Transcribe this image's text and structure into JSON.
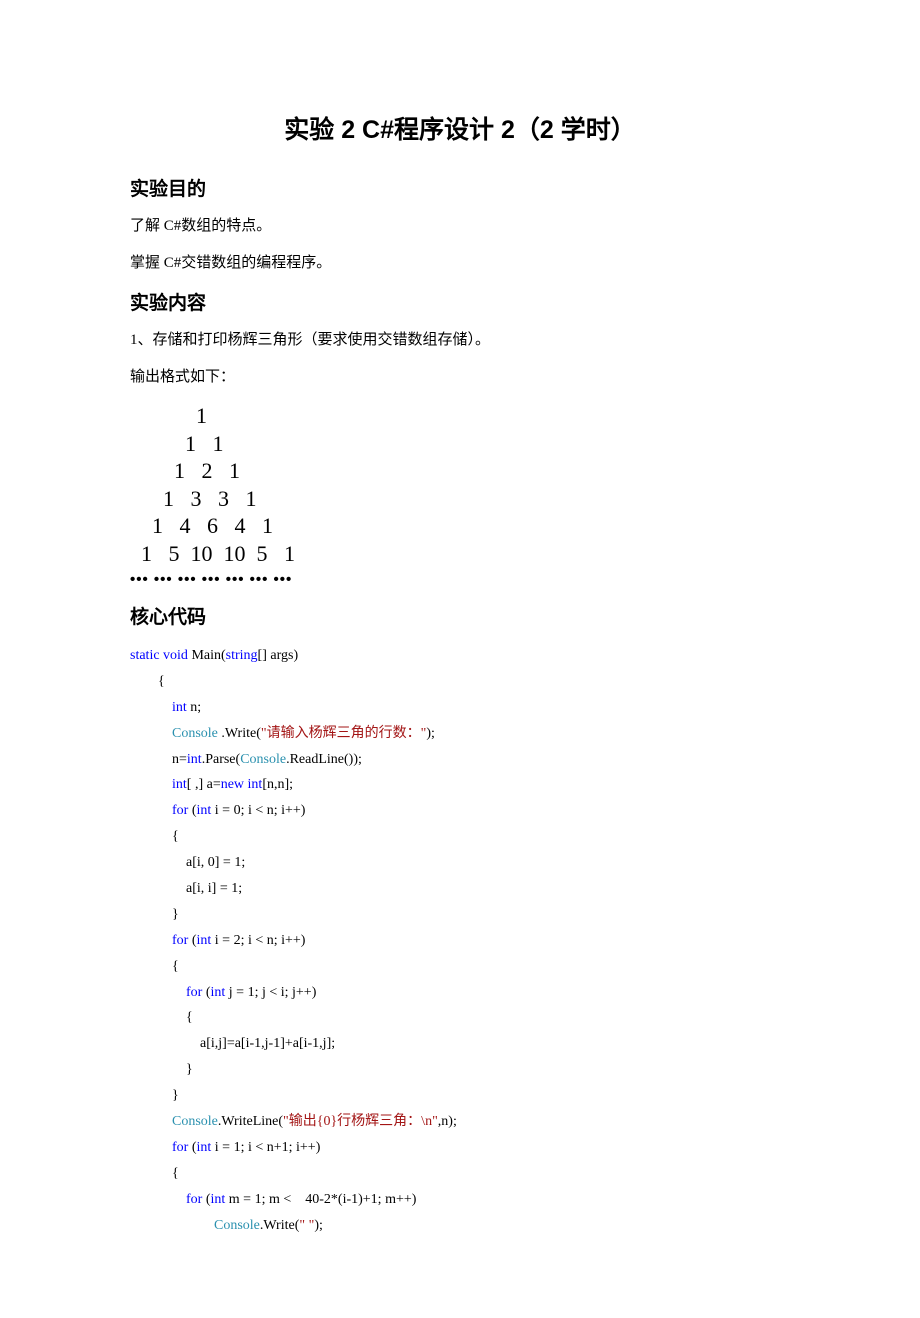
{
  "title": "实验 2    C#程序设计 2（2 学时）",
  "sections": {
    "purpose_heading": "实验目的",
    "purpose_p1": "了解 C#数组的特点。",
    "purpose_p2": "掌握 C#交错数组的编程程序。",
    "content_heading": "实验内容",
    "content_p1": "1、存储和打印杨辉三角形（要求使用交错数组存储）。",
    "content_p2": "输出格式如下：",
    "code_heading": "核心代码"
  },
  "triangle": {
    "rows": [
      "            1",
      "          1   1",
      "        1   2   1",
      "      1   3   3   1",
      "    1   4   6   4   1",
      "  1   5  10  10  5   1"
    ],
    "dots": "•••  •••  •••  •••   •••  ••• •••"
  },
  "code": {
    "lines": [
      [
        {
          "t": "static void",
          "c": "kw"
        },
        {
          "t": " Main("
        },
        {
          "t": "string",
          "c": "kw"
        },
        {
          "t": "[] args)"
        }
      ],
      [
        {
          "t": "        {"
        }
      ],
      [
        {
          "t": "            "
        },
        {
          "t": "int",
          "c": "kw"
        },
        {
          "t": " n;"
        }
      ],
      [
        {
          "t": "            "
        },
        {
          "t": "Console",
          "c": "cls"
        },
        {
          "t": " .Write("
        },
        {
          "t": "\"请输入杨辉三角的行数：\"",
          "c": "str"
        },
        {
          "t": ");"
        }
      ],
      [
        {
          "t": "            n="
        },
        {
          "t": "int",
          "c": "kw"
        },
        {
          "t": ".Parse("
        },
        {
          "t": "Console",
          "c": "cls"
        },
        {
          "t": ".ReadLine());"
        }
      ],
      [
        {
          "t": "            "
        },
        {
          "t": "int",
          "c": "kw"
        },
        {
          "t": "[ ,] a="
        },
        {
          "t": "new int",
          "c": "kw"
        },
        {
          "t": "[n,n];"
        }
      ],
      [
        {
          "t": "            "
        },
        {
          "t": "for",
          "c": "kw"
        },
        {
          "t": " ("
        },
        {
          "t": "int",
          "c": "kw"
        },
        {
          "t": " i = 0; i < n; i++)"
        }
      ],
      [
        {
          "t": "            {"
        }
      ],
      [
        {
          "t": "                a[i, 0] = 1;"
        }
      ],
      [
        {
          "t": "                a[i, i] = 1;"
        }
      ],
      [
        {
          "t": "            }"
        }
      ],
      [
        {
          "t": "            "
        },
        {
          "t": "for",
          "c": "kw"
        },
        {
          "t": " ("
        },
        {
          "t": "int",
          "c": "kw"
        },
        {
          "t": " i = 2; i < n; i++)"
        }
      ],
      [
        {
          "t": "            {"
        }
      ],
      [
        {
          "t": "                "
        },
        {
          "t": "for",
          "c": "kw"
        },
        {
          "t": " ("
        },
        {
          "t": "int",
          "c": "kw"
        },
        {
          "t": " j = 1; j < i; j++)"
        }
      ],
      [
        {
          "t": "                {"
        }
      ],
      [
        {
          "t": "                    a[i,j]=a[i-1,j-1]+a[i-1,j];"
        }
      ],
      [
        {
          "t": "                }"
        }
      ],
      [
        {
          "t": "            }"
        }
      ],
      [
        {
          "t": "            "
        },
        {
          "t": "Console",
          "c": "cls"
        },
        {
          "t": ".WriteLine("
        },
        {
          "t": "\"输出{0}行杨辉三角：\\n\"",
          "c": "str"
        },
        {
          "t": ",n);"
        }
      ],
      [
        {
          "t": "            "
        },
        {
          "t": "for",
          "c": "kw"
        },
        {
          "t": " ("
        },
        {
          "t": "int",
          "c": "kw"
        },
        {
          "t": " i = 1; i < n+1; i++)"
        }
      ],
      [
        {
          "t": "            {"
        }
      ],
      [
        {
          "t": "                "
        },
        {
          "t": "for",
          "c": "kw"
        },
        {
          "t": " ("
        },
        {
          "t": "int",
          "c": "kw"
        },
        {
          "t": " m = 1; m <    40-2*(i-1)+1; m++)"
        }
      ],
      [
        {
          "t": "                        "
        },
        {
          "t": "Console",
          "c": "cls"
        },
        {
          "t": ".Write("
        },
        {
          "t": "\" \"",
          "c": "str"
        },
        {
          "t": ");"
        }
      ]
    ]
  }
}
